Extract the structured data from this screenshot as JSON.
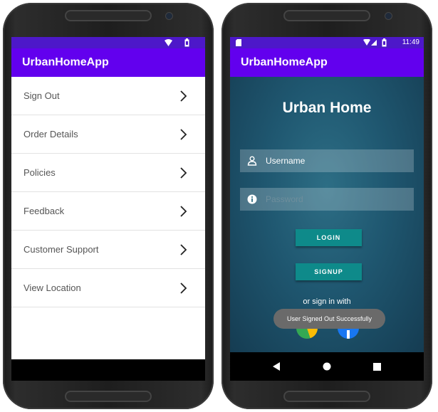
{
  "left": {
    "app_title": "UrbanHomeApp",
    "menu_items": [
      {
        "label": "Sign Out"
      },
      {
        "label": "Order Details"
      },
      {
        "label": "Policies"
      },
      {
        "label": "Feedback"
      },
      {
        "label": "Customer Support"
      },
      {
        "label": "View Location"
      }
    ]
  },
  "right": {
    "status_time": "11:49",
    "app_title": "UrbanHomeApp",
    "heading": "Urban Home",
    "username_placeholder": "Username",
    "password_placeholder": "Password",
    "login_label": "LOGIN",
    "signup_label": "SIGNUP",
    "or_text": "or sign in with",
    "toast": "User Signed Out Successfully"
  },
  "colors": {
    "primary": "#6200ee",
    "primary_dark": "#4d18c9",
    "button": "#0e8a8a"
  }
}
